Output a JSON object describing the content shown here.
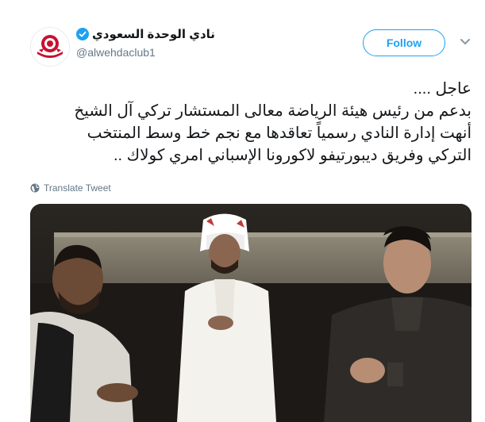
{
  "tweet": {
    "author_name": "نادي الوحدة السعودي",
    "handle": "@alwehdaclub1",
    "follow_label": "Follow",
    "text_lines": [
      "عاجل ....",
      "بدعم من رئيس هيئة الرياضة معالى المستشار تركي آل الشيخ",
      "أنهت إدارة النادي رسمياً تعاقدها مع نجم خط وسط المنتخب",
      "التركي وفريق ديبورتيفو لاكورونا الإسباني امري كولاك .."
    ],
    "translate_label": "Translate Tweet"
  },
  "colors": {
    "accent": "#1da1f2",
    "text": "#14171a",
    "secondary": "#657786",
    "logo_red": "#c8102e"
  },
  "icons": {
    "verified": "verified-badge-icon",
    "chevron": "chevron-down-icon",
    "globe": "globe-icon"
  }
}
